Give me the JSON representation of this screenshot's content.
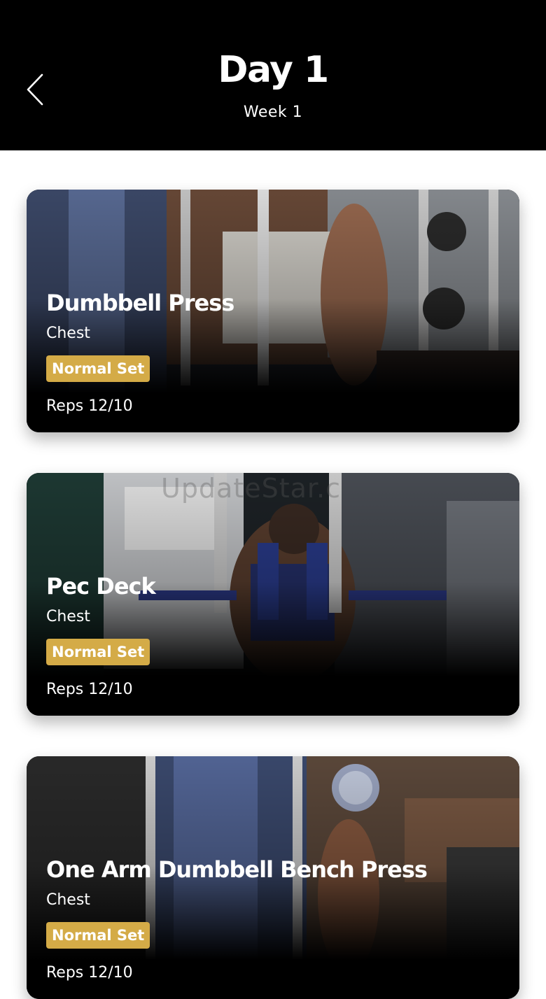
{
  "header": {
    "title": "Day 1",
    "subtitle": "Week 1",
    "back_icon": "chevron-left-icon"
  },
  "exercises": [
    {
      "name": "Dumbbell Press",
      "muscle": "Chest",
      "set_type": "Normal Set",
      "reps": "Reps 12/10"
    },
    {
      "name": "Pec Deck",
      "muscle": "Chest",
      "set_type": "Normal Set",
      "reps": "Reps 12/10"
    },
    {
      "name": "One Arm Dumbbell Bench Press",
      "muscle": "Chest",
      "set_type": "Normal Set",
      "reps": "Reps 12/10"
    }
  ],
  "watermark": "UpdateStar.c",
  "colors": {
    "header_bg": "#000000",
    "badge": "#d4ab47",
    "page_bg": "#ffffff"
  }
}
